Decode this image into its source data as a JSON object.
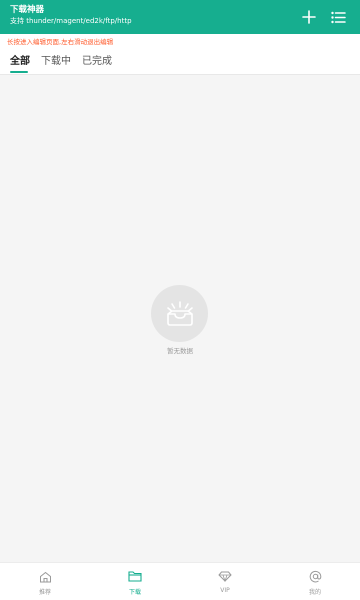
{
  "header": {
    "title": "下载神器",
    "subtitle": "支持 thunder/magent/ed2k/ftp/http",
    "add_icon": "plus-icon",
    "menu_icon": "list-icon"
  },
  "notice": {
    "text": "长按进入编辑页面,左右滑动退出编辑"
  },
  "tabs": [
    {
      "label": "全部",
      "active": true
    },
    {
      "label": "下载中",
      "active": false
    },
    {
      "label": "已完成",
      "active": false
    }
  ],
  "empty": {
    "icon": "empty-tray-icon",
    "text": "暂无数据"
  },
  "bottom_nav": [
    {
      "label": "推荐",
      "icon": "home-icon",
      "active": false
    },
    {
      "label": "下载",
      "icon": "folder-icon",
      "active": true
    },
    {
      "label": "VIP",
      "icon": "diamond-icon",
      "active": false
    },
    {
      "label": "我的",
      "icon": "at-icon",
      "active": false
    }
  ],
  "colors": {
    "brand": "#16ae8f",
    "notice": "#ff5a2b",
    "background": "#f5f5f5",
    "muted": "#9a9a9a"
  }
}
